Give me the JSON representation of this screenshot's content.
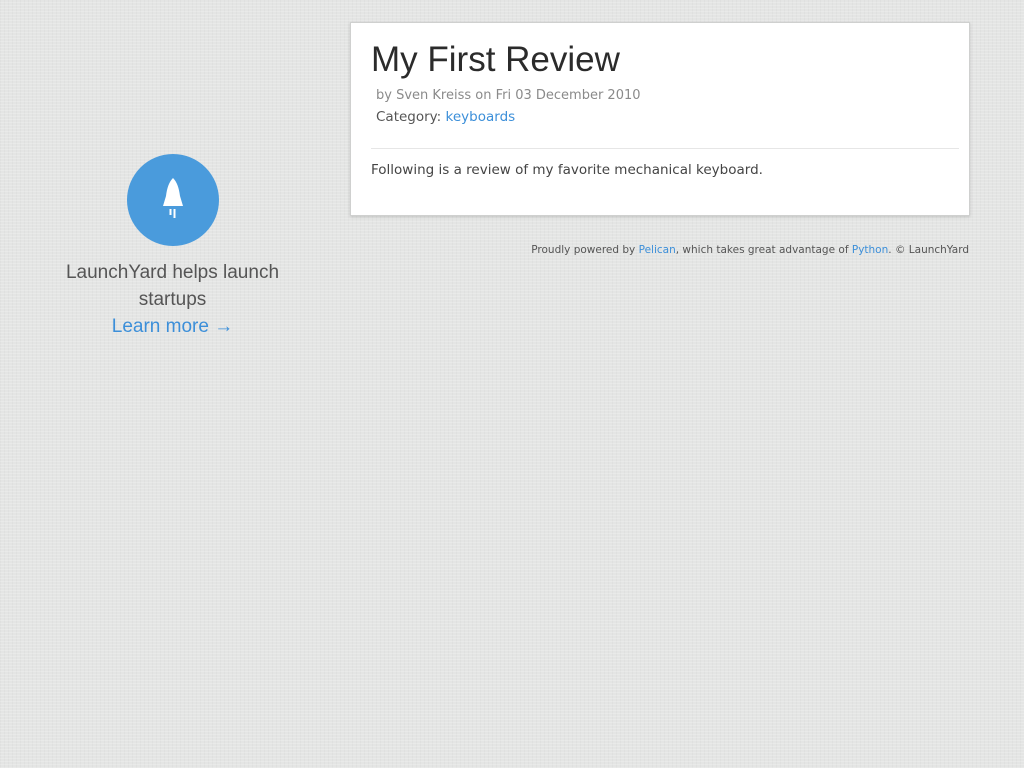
{
  "sidebar": {
    "logo_icon": "rocket-icon",
    "logo_color": "#4a9bdc",
    "tagline": "LaunchYard helps launch startups",
    "learn_more": "Learn more →"
  },
  "article": {
    "title": "My First Review",
    "byline": "by Sven Kreiss on Fri 03 December 2010",
    "category_label": "Category:",
    "category_value": "keyboards",
    "summary": "Following is a review of my favorite mechanical keyboard."
  },
  "footer": {
    "prefix": "Proudly powered by ",
    "pelican_link": "Pelican",
    "middle": ", which takes great advantage of ",
    "python_link": "Python",
    "suffix": ". © LaunchYard"
  },
  "colors": {
    "accent": "#3c8fd9",
    "background": "#e4e5e4",
    "card": "#ffffff"
  }
}
